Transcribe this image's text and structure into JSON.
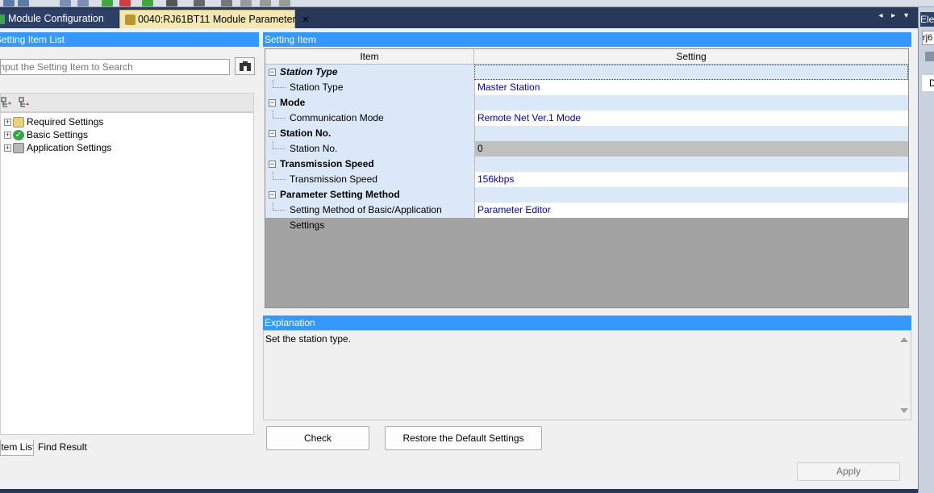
{
  "tabs": {
    "module_configuration": "Module Configuration",
    "module_parameter": "0040:RJ61BT11 Module Parameter",
    "close_glyph": "✕",
    "nav_glyphs": "◂ ▸ ▾"
  },
  "right_panel": {
    "header_partial": "Ele",
    "field_partial": "rj6",
    "tab_partial": "D"
  },
  "left_panel": {
    "header": "Setting Item List",
    "search_placeholder": "Input the Setting Item to Search",
    "tree": [
      {
        "label": "Required Settings",
        "icon": "folder-icon"
      },
      {
        "label": "Basic Settings",
        "icon": "check-icon"
      },
      {
        "label": "Application Settings",
        "icon": "settings-icon"
      }
    ],
    "bottom_tabs": {
      "item_list": "Item List",
      "find_result": "Find Result"
    }
  },
  "setting_item": {
    "header": "Setting Item",
    "col_item": "Item",
    "col_setting": "Setting",
    "rows": [
      {
        "category": "Station Type"
      },
      {
        "item": "Station Type",
        "value": "Master Station"
      },
      {
        "category": "Mode"
      },
      {
        "item": "Communication Mode",
        "value": "Remote Net Ver.1 Mode"
      },
      {
        "category": "Station No."
      },
      {
        "item": "Station No.",
        "value": "0"
      },
      {
        "category": "Transmission Speed"
      },
      {
        "item": "Transmission Speed",
        "value": "156kbps"
      },
      {
        "category": "Parameter Setting Method"
      },
      {
        "item": "Setting Method of Basic/Application Settings",
        "value": "Parameter Editor"
      }
    ]
  },
  "explanation": {
    "header": "Explanation",
    "text": "Set the station type."
  },
  "buttons": {
    "check": "Check",
    "restore": "Restore the Default Settings",
    "apply": "Apply"
  },
  "colors": {
    "accent_header": "#3399ff",
    "value_text": "#0000cc",
    "row_bg": "#dbe8f8"
  }
}
